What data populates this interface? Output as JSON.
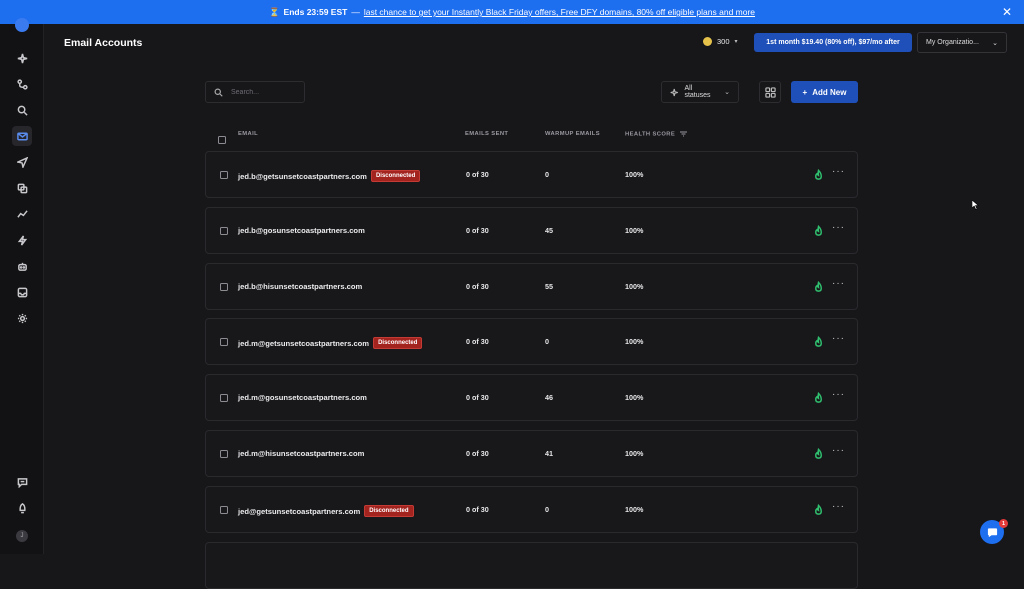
{
  "banner": {
    "emoji": "⏳",
    "strong": "Ends 23:59 EST",
    "dash": "—",
    "link": "last chance to get your Instantly Black Friday offers, Free DFY domains, 80% off eligible plans and more",
    "close": "✕"
  },
  "header": {
    "title": "Email Accounts",
    "credits": "300",
    "promo": "1st month $19.40 (80% off), $97/mo after",
    "org": "My Organizatio..."
  },
  "toolbar": {
    "search_placeholder": "Search...",
    "status_filter": "All statuses",
    "add_label": "Add New",
    "add_plus": "+"
  },
  "table": {
    "headers": {
      "email": "EMAIL",
      "sent": "EMAILS SENT",
      "warmup": "WARMUP EMAILS",
      "health": "HEALTH SCORE"
    },
    "rows": [
      {
        "email": "jed.b@getsunsetcoastpartners.com",
        "badge": "Disconnected",
        "sent": "0 of 30",
        "warmup": "0",
        "health": "100%"
      },
      {
        "email": "jed.b@gosunsetcoastpartners.com",
        "badge": "",
        "sent": "0 of 30",
        "warmup": "45",
        "health": "100%"
      },
      {
        "email": "jed.b@hisunsetcoastpartners.com",
        "badge": "",
        "sent": "0 of 30",
        "warmup": "55",
        "health": "100%"
      },
      {
        "email": "jed.m@getsunsetcoastpartners.com",
        "badge": "Disconnected",
        "sent": "0 of 30",
        "warmup": "0",
        "health": "100%"
      },
      {
        "email": "jed.m@gosunsetcoastpartners.com",
        "badge": "",
        "sent": "0 of 30",
        "warmup": "46",
        "health": "100%"
      },
      {
        "email": "jed.m@hisunsetcoastpartners.com",
        "badge": "",
        "sent": "0 of 30",
        "warmup": "41",
        "health": "100%"
      },
      {
        "email": "jed@getsunsetcoastpartners.com",
        "badge": "Disconnected",
        "sent": "0 of 30",
        "warmup": "0",
        "health": "100%"
      }
    ],
    "more_glyph": "···"
  },
  "sidebar": {
    "user_initial": "J"
  },
  "chat": {
    "count": "1"
  },
  "colors": {
    "accent": "#1e6ef0",
    "button": "#1f4fb8",
    "danger": "#a3231f",
    "health": "#2fbf6e"
  }
}
